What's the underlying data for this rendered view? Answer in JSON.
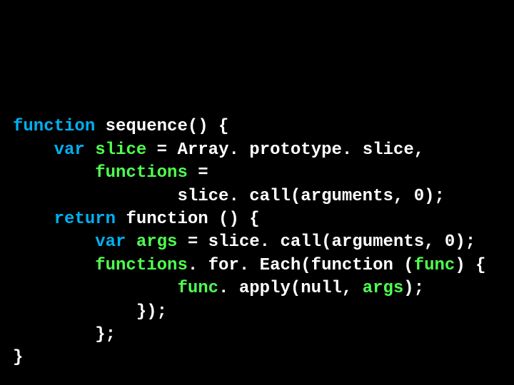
{
  "code": {
    "kw_function": "function",
    "kw_var": "var",
    "kw_return": "return",
    "fname": "sequence",
    "open": "() {",
    "var_slice": "slice",
    "var_functions": "functions",
    "var_args": "args",
    "var_func": "func",
    "eq": " = ",
    "comma": ",",
    "semicolon": ";",
    "array_proto_slice": "Array. prototype. slice",
    "slice_call_args0": "slice. call(arguments, 0)",
    "func_open": "function () {",
    "functions_foreach": ". for. Each(function (",
    "paren_brace_open": ") {",
    "func_apply_null": ". apply(null, ",
    "close_paren_semi": ");",
    "close_brace_paren_semi": "});",
    "close_brace_semi": "};",
    "close_brace": "}",
    "space1": " ",
    "indent1": "    ",
    "indent2": "        ",
    "indent3": "            ",
    "indent4": "                "
  }
}
